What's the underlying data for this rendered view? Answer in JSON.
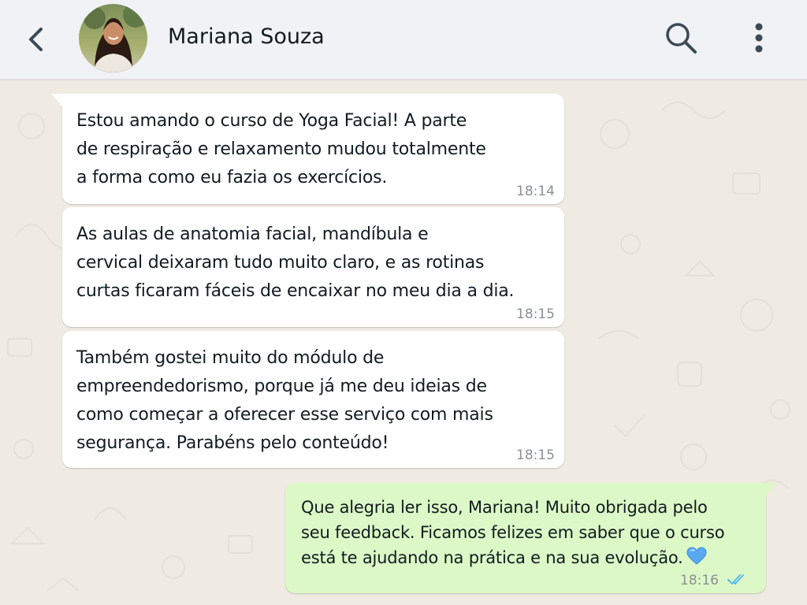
{
  "header": {
    "contact_name": "Mariana Souza",
    "icons": {
      "back": "chevron-left-icon",
      "search": "search-icon",
      "menu": "more-vertical-icon"
    }
  },
  "messages": [
    {
      "direction": "incoming",
      "lines": [
        "Estou amando o curso de Yoga Facial! A parte",
        "de respiração e relaxamento mudou totalmente",
        "a forma como eu fazia os exercícios."
      ],
      "time": "18:14"
    },
    {
      "direction": "incoming",
      "lines": [
        "As aulas de anatomia facial, mandíbula e",
        "cervical deixaram tudo muito claro, e as rotinas",
        "curtas ficaram fáceis de encaixar no meu dia a dia."
      ],
      "time": "18:15"
    },
    {
      "direction": "incoming",
      "lines": [
        "Também gostei muito do módulo de",
        "empreendedorismo, porque já me deu ideias de",
        "como começar a oferecer esse serviço com mais",
        "segurança. Parabéns pelo conteúdo!"
      ],
      "time": "18:15"
    },
    {
      "direction": "outgoing",
      "lines": [
        "Que alegria ler isso, Mariana! Muito obrigada pelo",
        "seu feedback. Ficamos felizes em saber que o curso",
        "está te ajudando na prática e na sua evolução."
      ],
      "emoji": "blue-heart-icon",
      "time": "18:16",
      "status": "read-double-check-icon"
    }
  ],
  "colors": {
    "chat_background": "#efeae2",
    "header_background": "#f0f2f5",
    "incoming_bubble": "#ffffff",
    "outgoing_bubble": "#dcf8c6",
    "read_ticks": "#53bdeb",
    "heart": "#5aa9f0"
  }
}
